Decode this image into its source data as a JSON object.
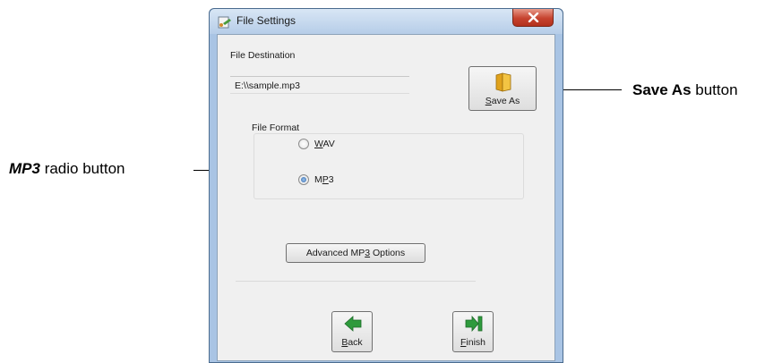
{
  "window": {
    "title": "File Settings",
    "close_glyph": "x"
  },
  "file_destination": {
    "label": "File Destination",
    "value": "E:\\\\sample.mp3"
  },
  "save_as_button": {
    "mnemonic": "S",
    "rest": "ave As",
    "icon": "folder-icon"
  },
  "file_format": {
    "label": "File Format",
    "options": [
      {
        "mnemonic": "W",
        "rest": "AV",
        "selected": false
      },
      {
        "pre": "M",
        "mnemonic": "P",
        "rest": "3",
        "selected": true
      }
    ]
  },
  "advanced_button": {
    "pre": "Advanced MP",
    "mnemonic": "3",
    "rest": " Options"
  },
  "nav": {
    "back": {
      "mnemonic": "B",
      "rest": "ack",
      "icon": "back-arrow-icon"
    },
    "finish": {
      "mnemonic": "F",
      "rest": "inish",
      "icon": "finish-icon"
    }
  },
  "callouts": {
    "save_as": {
      "bold": "Save As",
      "rest": " button"
    },
    "mp3": {
      "bold": "MP3",
      "rest": " radio button"
    }
  },
  "colors": {
    "accent_green": "#2e9a3c",
    "close_red": "#c6432f",
    "frame_blue": "#a9c4e4"
  }
}
